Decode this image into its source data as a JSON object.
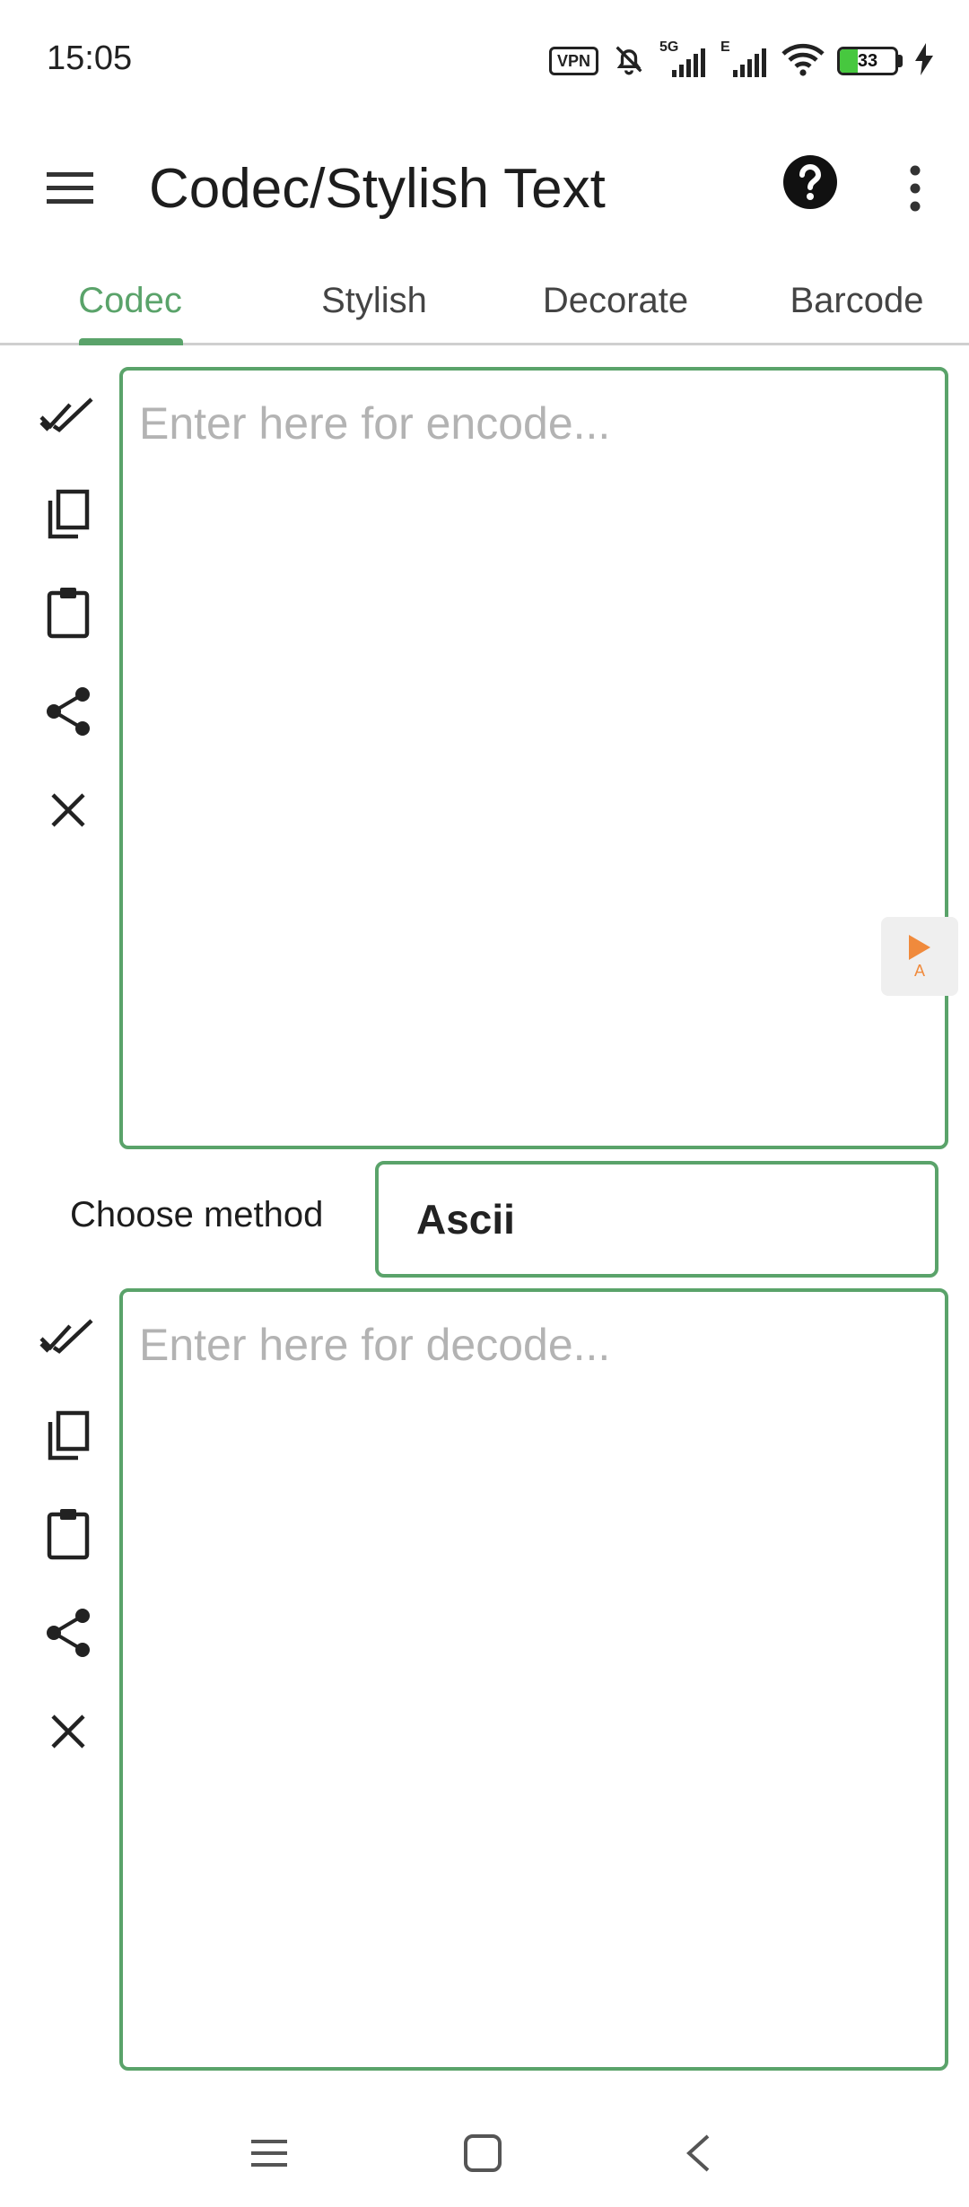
{
  "status_bar": {
    "time": "15:05",
    "vpn_label": "VPN",
    "network_5g": "5G",
    "network_e": "E",
    "battery_level": "33",
    "battery_fraction": 0.33,
    "icons": [
      "vpn-icon",
      "mute-bell-icon",
      "signal-5g-icon",
      "signal-e-icon",
      "wifi-icon",
      "battery-icon",
      "charging-bolt-icon"
    ]
  },
  "app_bar": {
    "title": "Codec/Stylish Text",
    "menu_icon": "hamburger-menu-icon",
    "help_icon": "help-icon",
    "more_icon": "more-vertical-icon"
  },
  "tabs": [
    {
      "label": "Codec",
      "active": true
    },
    {
      "label": "Stylish",
      "active": false
    },
    {
      "label": "Decorate",
      "active": false
    },
    {
      "label": "Barcode",
      "active": false
    }
  ],
  "encode": {
    "placeholder": "Enter here for encode...",
    "value": "",
    "tools": [
      "select-all-icon",
      "copy-icon",
      "paste-icon",
      "share-icon",
      "clear-icon"
    ]
  },
  "method": {
    "label": "Choose method",
    "selected": "Ascii"
  },
  "decode": {
    "placeholder": "Enter here for decode...",
    "value": "",
    "tools": [
      "select-all-icon",
      "copy-icon",
      "paste-icon",
      "share-icon",
      "clear-icon"
    ]
  },
  "float_tab": {
    "icon": "play-icon",
    "letter": "A"
  },
  "nav_bar": {
    "icons": [
      "recents-menu-icon",
      "home-icon",
      "back-icon"
    ]
  },
  "colors": {
    "accent": "#5aa36a",
    "battery": "#47c83f",
    "float_play": "#f08a3c"
  }
}
